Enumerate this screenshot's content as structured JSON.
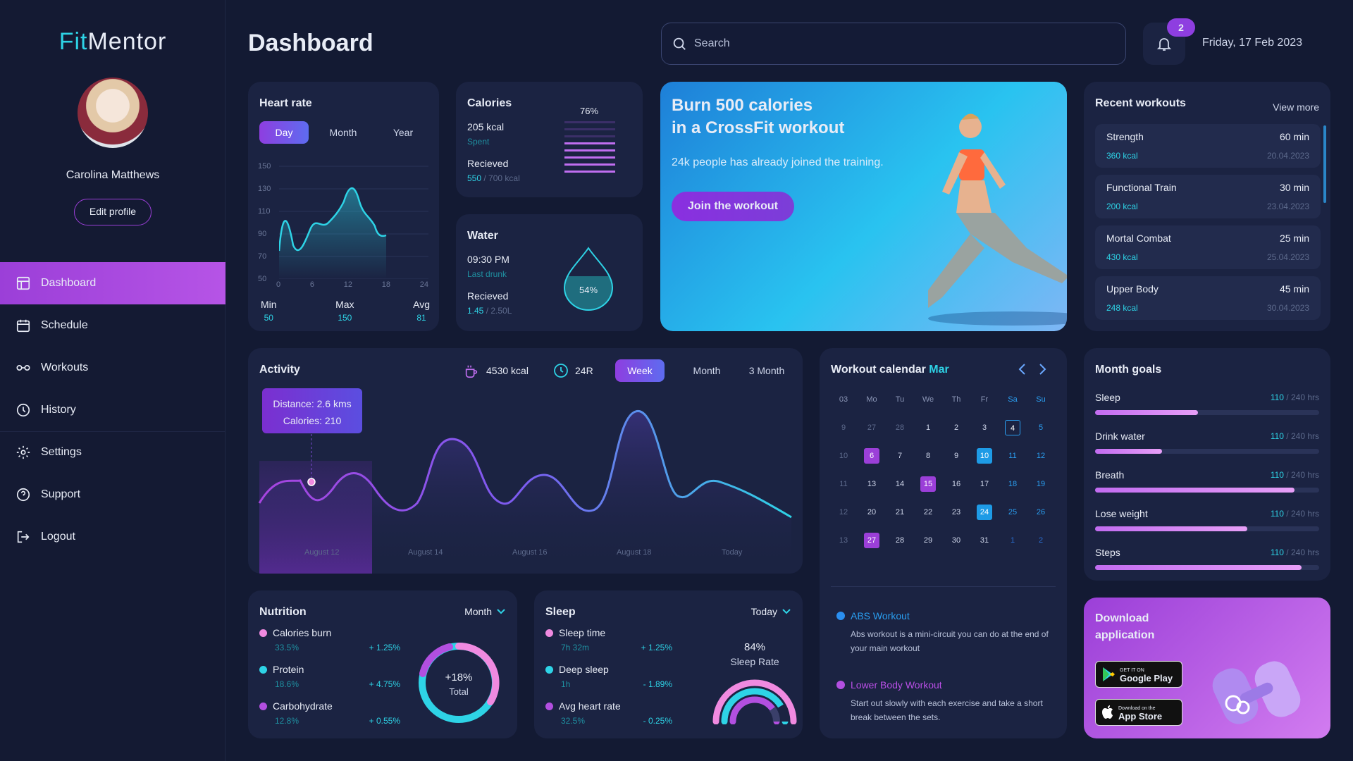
{
  "app": {
    "logo_a": "Fit",
    "logo_b": "Mentor"
  },
  "user": {
    "name": "Carolina Matthews",
    "edit": "Edit profile"
  },
  "nav": [
    {
      "label": "Dashboard",
      "icon": "dashboard-icon"
    },
    {
      "label": "Schedule",
      "icon": "calendar-icon"
    },
    {
      "label": "Workouts",
      "icon": "workouts-icon"
    },
    {
      "label": "History",
      "icon": "history-icon"
    },
    {
      "label": "Settings",
      "icon": "gear-icon"
    },
    {
      "label": "Support",
      "icon": "help-icon"
    },
    {
      "label": "Logout",
      "icon": "logout-icon"
    }
  ],
  "header": {
    "title": "Dashboard",
    "search_placeholder": "Search",
    "notif_count": "2",
    "date": "Friday, 17 Feb 2023"
  },
  "heart": {
    "title": "Heart rate",
    "tabs": [
      "Day",
      "Month",
      "Year"
    ],
    "yticks": [
      "150",
      "130",
      "110",
      "90",
      "70",
      "50"
    ],
    "xticks": [
      "0",
      "6",
      "12",
      "18",
      "24"
    ],
    "stats": [
      {
        "label": "Min",
        "value": "50"
      },
      {
        "label": "Max",
        "value": "150"
      },
      {
        "label": "Avg",
        "value": "81"
      }
    ]
  },
  "calories": {
    "title": "Calories",
    "pct": "76%",
    "spent_val": "205 kcal",
    "spent_lbl": "Spent",
    "recv_lbl": "Recieved",
    "recv_a": "550",
    "recv_b": " / 700 kcal"
  },
  "water": {
    "title": "Water",
    "time": "09:30 PM",
    "time_lbl": "Last drunk",
    "recv_lbl": "Recieved",
    "recv_a": "1.45",
    "recv_b": " / 2.50L",
    "pct": "54%"
  },
  "promo": {
    "line1": "Burn 500 calories",
    "line2": "in a CrossFit workout",
    "sub": "24k people has already joined the training.",
    "btn": "Join the workout"
  },
  "recent": {
    "title": "Recent workouts",
    "more": "View more",
    "items": [
      {
        "name": "Strength",
        "dur": "60 min",
        "kcal": "360 kcal",
        "date": "20.04.2023"
      },
      {
        "name": "Functional Train",
        "dur": "30 min",
        "kcal": "200 kcal",
        "date": "23.04.2023"
      },
      {
        "name": "Mortal Combat",
        "dur": "25 min",
        "kcal": "430 kcal",
        "date": "25.04.2023"
      },
      {
        "name": "Upper Body",
        "dur": "45 min",
        "kcal": "248 kcal",
        "date": "30.04.2023"
      }
    ]
  },
  "activity": {
    "title": "Activity",
    "kcal": "4530 kcal",
    "hours": "24R",
    "tabs": [
      "Week",
      "Month",
      "3 Month"
    ],
    "tip1": "Distance: 2.6 kms",
    "tip2": "Calories: 210",
    "xlabels": [
      "August 12",
      "August 14",
      "August 16",
      "August 18",
      "Today"
    ]
  },
  "calendar": {
    "title": "Workout calendar",
    "month": "Mar",
    "head": [
      "03",
      "Mo",
      "Tu",
      "We",
      "Th",
      "Fr",
      "Sa",
      "Su"
    ],
    "rows": [
      [
        "9",
        "27",
        "28",
        "1",
        "2",
        "3",
        "4",
        "5"
      ],
      [
        "10",
        "6",
        "7",
        "8",
        "9",
        "10",
        "11",
        "12"
      ],
      [
        "11",
        "13",
        "14",
        "15",
        "16",
        "17",
        "18",
        "19"
      ],
      [
        "12",
        "20",
        "21",
        "22",
        "23",
        "24",
        "25",
        "26"
      ],
      [
        "13",
        "27",
        "28",
        "29",
        "30",
        "31",
        "1",
        "2"
      ]
    ],
    "events": [
      {
        "title": "ABS Workout",
        "desc": "Abs workout is a mini-circuit you can do at the end of your main workout",
        "color": "#2a8ef0"
      },
      {
        "title": "Lower Body Workout",
        "desc": "Start out slowly with each exercise and take a short break between the sets.",
        "color": "#b24fe0"
      }
    ]
  },
  "goals": {
    "title": "Month goals",
    "items": [
      {
        "label": "Sleep",
        "a": "110",
        "b": " / 240 hrs",
        "pct": 0.46
      },
      {
        "label": "Drink water",
        "a": "110",
        "b": " / 240 hrs",
        "pct": 0.3
      },
      {
        "label": "Breath",
        "a": "110",
        "b": " / 240 hrs",
        "pct": 0.89
      },
      {
        "label": "Lose weight",
        "a": "110",
        "b": " / 240 hrs",
        "pct": 0.68
      },
      {
        "label": "Steps",
        "a": "110",
        "b": " / 240 hrs",
        "pct": 0.92
      }
    ]
  },
  "nutrition": {
    "title": "Nutrition",
    "period": "Month",
    "center1": "+18%",
    "center2": "Total",
    "items": [
      {
        "label": "Calories burn",
        "pct": "33.5%",
        "delta": "+ 1.25%",
        "color": "#f08ae0"
      },
      {
        "label": "Protein",
        "pct": "18.6%",
        "delta": "+ 4.75%",
        "color": "#2ed3e6"
      },
      {
        "label": "Carbohydrate",
        "pct": "12.8%",
        "delta": "+ 0.55%",
        "color": "#b24fe0"
      }
    ]
  },
  "sleep": {
    "title": "Sleep",
    "period": "Today",
    "rate": "84%",
    "rate_lbl": "Sleep Rate",
    "items": [
      {
        "label": "Sleep time",
        "sub": "7h 32m",
        "delta": "+ 1.25%",
        "color": "#f08ae0"
      },
      {
        "label": "Deep sleep",
        "sub": "1h",
        "delta": "- 1.89%",
        "color": "#2ed3e6"
      },
      {
        "label": "Avg heart rate",
        "sub": "32.5%",
        "delta": "- 0.25%",
        "color": "#b24fe0"
      }
    ]
  },
  "download": {
    "line1": "Download",
    "line2": "application",
    "gp_small": "GET IT ON",
    "gp": "Google Play",
    "as_small": "Download on the",
    "as": "App Store"
  }
}
